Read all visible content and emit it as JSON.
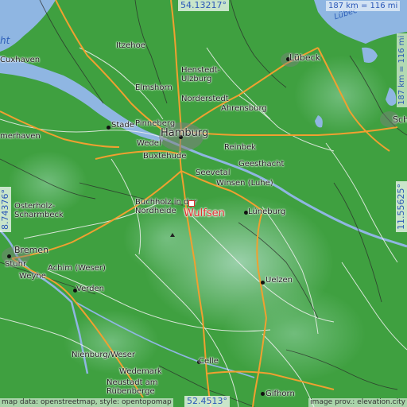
{
  "coordinates": {
    "top": "54.13217°",
    "bottom": "52.4513°",
    "left": "8.74376°",
    "right": "11.55625°"
  },
  "scales": {
    "top_right": "187 km = 116 mi",
    "right_vertical": "187 km = 116 mi"
  },
  "target": {
    "name": "Wulfsen",
    "color": "#e03030"
  },
  "places": {
    "hamburg": "Hamburg",
    "luebeck": "Lübeck",
    "bremen": "Bremen",
    "itzehoe": "Itzehoe",
    "cuxhaven": "Cuxhaven",
    "henstedt": "Henstedt-\nUlzburg",
    "elmshorn": "Elmshorn",
    "norderstedt": "Norderstedt",
    "ahrensburg": "Ahrensburg",
    "stade": "Stade",
    "pinneberg": "Pinneberg",
    "wedel": "Wedel",
    "reinbek": "Reinbek",
    "buxtehude": "Buxtehude",
    "geesthacht": "Geesthacht",
    "seevetal": "Seevetal",
    "winsen": "Winsen (Luhe)",
    "buchholz": "Buchholz in der\nNordheide",
    "lueneburg": "Lüneburg",
    "osterholz": "Osterholz-\nScharmbeck",
    "merhaven": "merhaven",
    "stuhr": "Stuhr",
    "weyhe": "Weyhe",
    "achim": "Achim (Weser)",
    "verden": "Verden",
    "uelzen": "Uelzen",
    "nienburg": "Nienburg/Weser",
    "wedemark": "Wedemark",
    "neustadt": "Neustadt am\nRübenberge",
    "celle": "Celle",
    "gifhorn": "Gifhorn",
    "schwerin": "Sch",
    "luebeck_bay": "Lübec",
    "bight": "ht"
  },
  "attribution": {
    "left": "map data: openstreetmap, style: opentopomap",
    "right": "image prov.: elevation.city"
  },
  "colors": {
    "lowland": "#3fa040",
    "highland": "#8fc9a0",
    "water": "#8fb6e2",
    "highway": "#f0a030",
    "road": "#f5f5f5"
  }
}
